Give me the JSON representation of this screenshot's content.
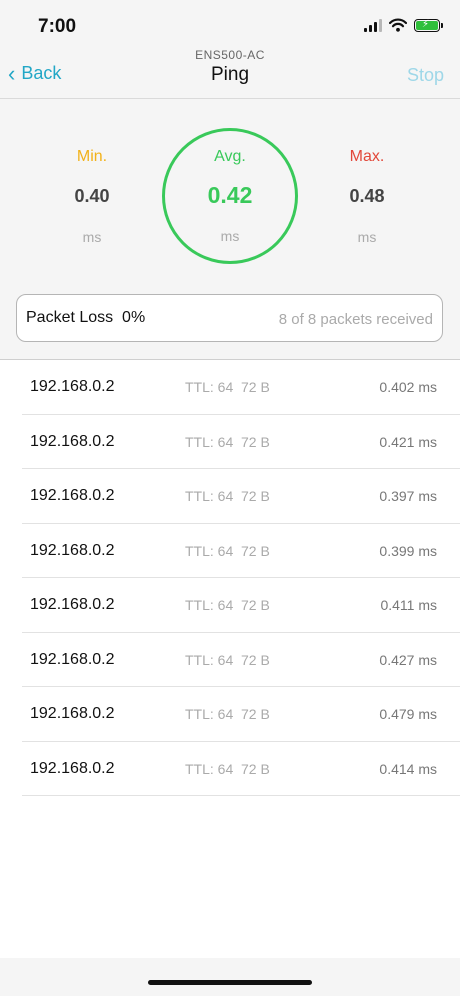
{
  "status_bar": {
    "time": "7:00",
    "icons": [
      "cellular-signal-icon",
      "wifi-icon",
      "battery-charging-icon"
    ],
    "battery_color": "#2fbf3a"
  },
  "nav": {
    "back_label": "Back",
    "device": "ENS500-AC",
    "title": "Ping",
    "stop_label": "Stop",
    "accent": "#22a7c6"
  },
  "stats": {
    "min": {
      "label": "Min.",
      "value": "0.40",
      "unit": "ms",
      "color": "#f2b21a"
    },
    "avg": {
      "label": "Avg.",
      "value": "0.42",
      "unit": "ms",
      "color": "#39c95a"
    },
    "max": {
      "label": "Max.",
      "value": "0.48",
      "unit": "ms",
      "color": "#e2483a"
    }
  },
  "packet_loss": {
    "label": "Packet Loss  0%",
    "received": "8 of 8 packets received"
  },
  "rows": [
    {
      "ip": "192.168.0.2",
      "ttl": "TTL: 64  72 B",
      "time": "0.402 ms"
    },
    {
      "ip": "192.168.0.2",
      "ttl": "TTL: 64  72 B",
      "time": "0.421 ms"
    },
    {
      "ip": "192.168.0.2",
      "ttl": "TTL: 64  72 B",
      "time": "0.397 ms"
    },
    {
      "ip": "192.168.0.2",
      "ttl": "TTL: 64  72 B",
      "time": "0.399 ms"
    },
    {
      "ip": "192.168.0.2",
      "ttl": "TTL: 64  72 B",
      "time": "0.411 ms"
    },
    {
      "ip": "192.168.0.2",
      "ttl": "TTL: 64  72 B",
      "time": "0.427 ms"
    },
    {
      "ip": "192.168.0.2",
      "ttl": "TTL: 64  72 B",
      "time": "0.479 ms"
    },
    {
      "ip": "192.168.0.2",
      "ttl": "TTL: 64  72 B",
      "time": "0.414 ms"
    }
  ]
}
